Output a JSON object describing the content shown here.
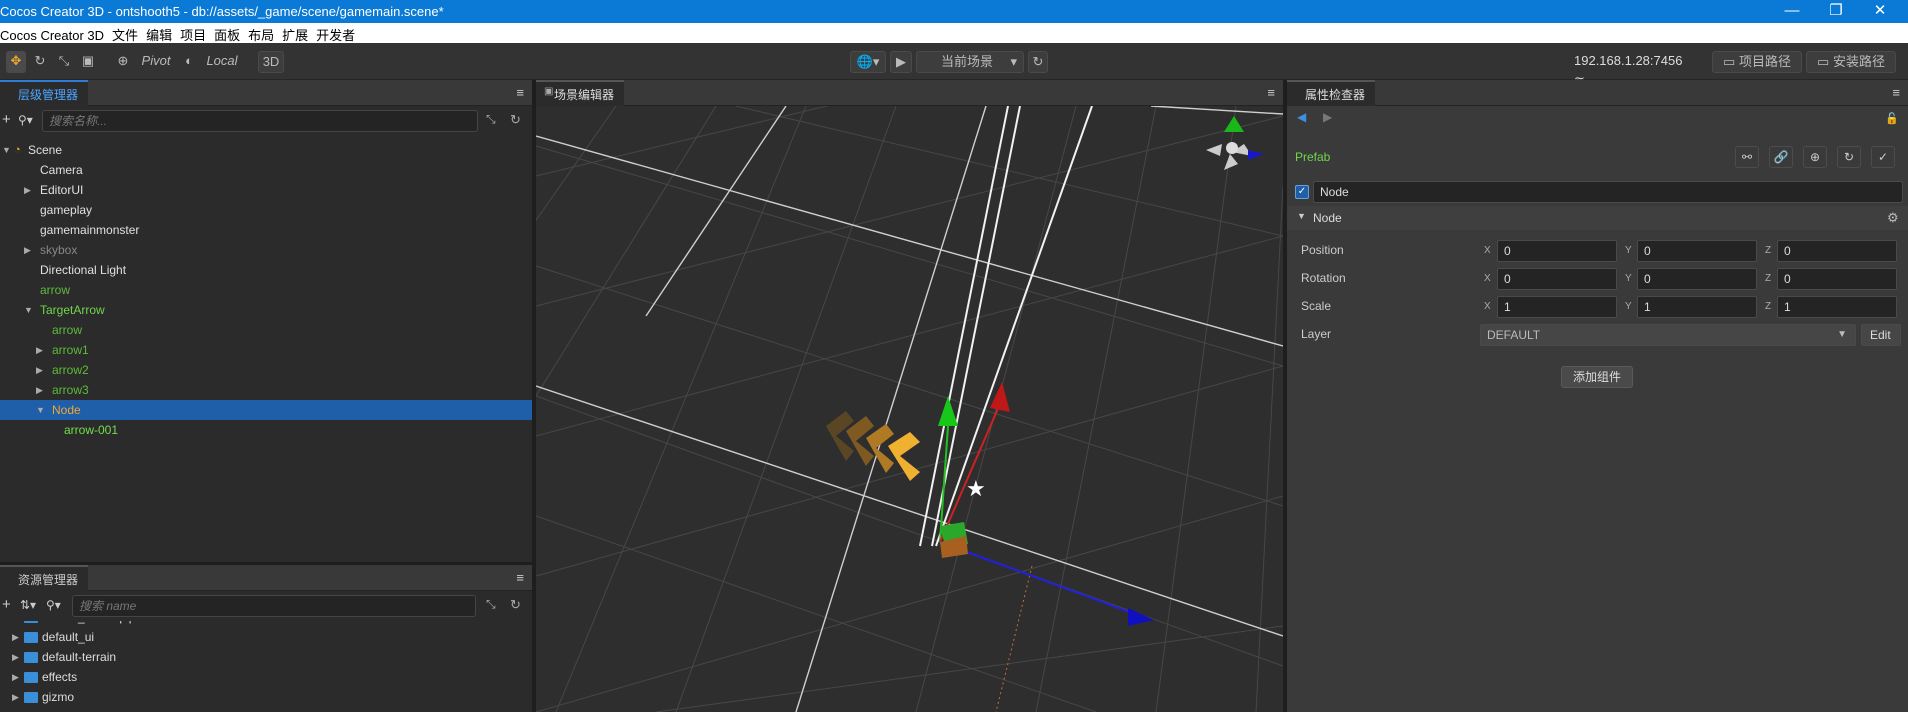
{
  "window": {
    "title": "Cocos Creator 3D - ontshooth5 - db://assets/_game/scene/gamemain.scene*",
    "minimize": "—",
    "restore": "❐",
    "close": "✕"
  },
  "menu": [
    "Cocos Creator 3D",
    "文件",
    "编辑",
    "项目",
    "面板",
    "布局",
    "扩展",
    "开发者"
  ],
  "toolbar": {
    "pivot_label": "Pivot",
    "local_label": "Local",
    "mode_3d": "3D",
    "scene_select": "当前场景",
    "ip": "192.168.1.28:7456",
    "project_path": "项目路径",
    "install_path": "安装路径"
  },
  "hierarchy": {
    "tab": "层级管理器",
    "search_placeholder": "搜索名称...",
    "items": [
      {
        "name": "Scene",
        "color": "#e0e0e0",
        "indent": 0,
        "arrow": "▼",
        "icon": "scene-icon"
      },
      {
        "name": "Camera",
        "color": "#e0e0e0",
        "indent": 1,
        "arrow": ""
      },
      {
        "name": "EditorUI",
        "color": "#e0e0e0",
        "indent": 1,
        "arrow": "▶"
      },
      {
        "name": "gameplay",
        "color": "#e0e0e0",
        "indent": 1,
        "arrow": ""
      },
      {
        "name": "gamemainmonster",
        "color": "#e0e0e0",
        "indent": 1,
        "arrow": ""
      },
      {
        "name": "skybox",
        "color": "#888888",
        "indent": 1,
        "arrow": "▶"
      },
      {
        "name": "Directional Light",
        "color": "#e0e0e0",
        "indent": 1,
        "arrow": ""
      },
      {
        "name": "arrow",
        "color": "#5dbb3a",
        "indent": 1,
        "arrow": ""
      },
      {
        "name": "TargetArrow",
        "color": "#6fd64a",
        "indent": 1,
        "arrow": "▼"
      },
      {
        "name": "arrow",
        "color": "#5dbb3a",
        "indent": 2,
        "arrow": ""
      },
      {
        "name": "arrow1",
        "color": "#5dbb3a",
        "indent": 2,
        "arrow": "▶"
      },
      {
        "name": "arrow2",
        "color": "#5dbb3a",
        "indent": 2,
        "arrow": "▶"
      },
      {
        "name": "arrow3",
        "color": "#5dbb3a",
        "indent": 2,
        "arrow": "▶"
      },
      {
        "name": "Node",
        "color": "#f0a830",
        "indent": 2,
        "arrow": "▼",
        "selected": true
      },
      {
        "name": "arrow-001",
        "color": "#6fe04a",
        "indent": 3,
        "arrow": ""
      }
    ]
  },
  "assets": {
    "tab": "资源管理器",
    "search_placeholder": "搜索 name",
    "items": [
      "default_renderpipeline",
      "default_ui",
      "default-terrain",
      "effects",
      "gizmo"
    ]
  },
  "scene_editor": {
    "tab": "场景编辑器"
  },
  "inspector": {
    "tab": "属性检查器",
    "prefab_label": "Prefab",
    "node_name": "Node",
    "node_checked": true,
    "section": "Node",
    "position": {
      "label": "Position",
      "x": "0",
      "y": "0",
      "z": "0"
    },
    "rotation": {
      "label": "Rotation",
      "x": "0",
      "y": "0",
      "z": "0"
    },
    "scale": {
      "label": "Scale",
      "x": "1",
      "y": "1",
      "z": "1"
    },
    "layer": {
      "label": "Layer",
      "value": "DEFAULT",
      "edit": "Edit"
    },
    "add_component": "添加组件",
    "axis_x": "X",
    "axis_y": "Y",
    "axis_z": "Z"
  },
  "colors": {
    "accent": "#2f7bd6",
    "title_bar": "#0a7ad6",
    "prefab_green": "#6fd64a"
  }
}
